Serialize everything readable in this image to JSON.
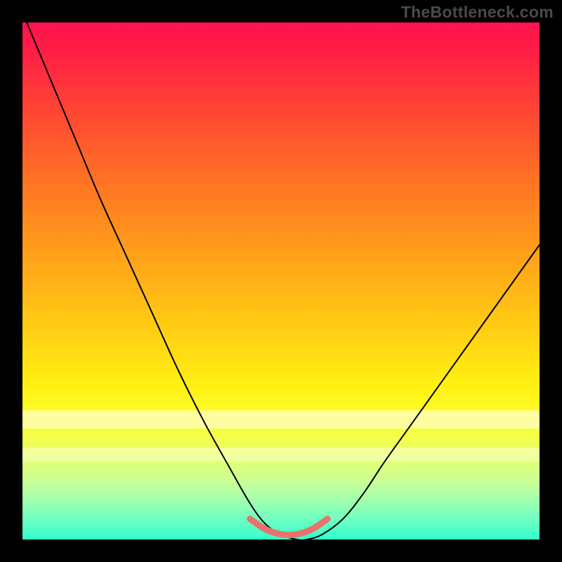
{
  "watermark": "TheBottleneck.com",
  "colors": {
    "background": "#000000",
    "gradient_top": "#ff124e",
    "gradient_bottom": "#33ffcb",
    "curve": "#000000",
    "marker": "#e9726d",
    "watermark": "#4a4a4a"
  },
  "chart_data": {
    "type": "line",
    "title": "",
    "xlabel": "",
    "ylabel": "",
    "xlim": [
      0,
      100
    ],
    "ylim": [
      0,
      100
    ],
    "annotations": [
      "TheBottleneck.com"
    ],
    "series": [
      {
        "name": "bottleneck-curve",
        "x": [
          0,
          5,
          10,
          15,
          20,
          25,
          30,
          35,
          40,
          44,
          47,
          50,
          53,
          55,
          58,
          62,
          66,
          70,
          75,
          80,
          85,
          90,
          95,
          100
        ],
        "values": [
          102,
          90,
          78,
          66,
          55,
          44,
          33,
          23,
          14,
          7,
          3,
          1,
          0,
          0,
          1,
          4,
          9,
          15,
          22,
          29,
          36,
          43,
          50,
          57
        ]
      },
      {
        "name": "highlight-flat-bottom",
        "x": [
          44,
          47,
          50,
          53,
          56,
          59
        ],
        "values": [
          4,
          2,
          1,
          1,
          2,
          4
        ]
      }
    ]
  }
}
